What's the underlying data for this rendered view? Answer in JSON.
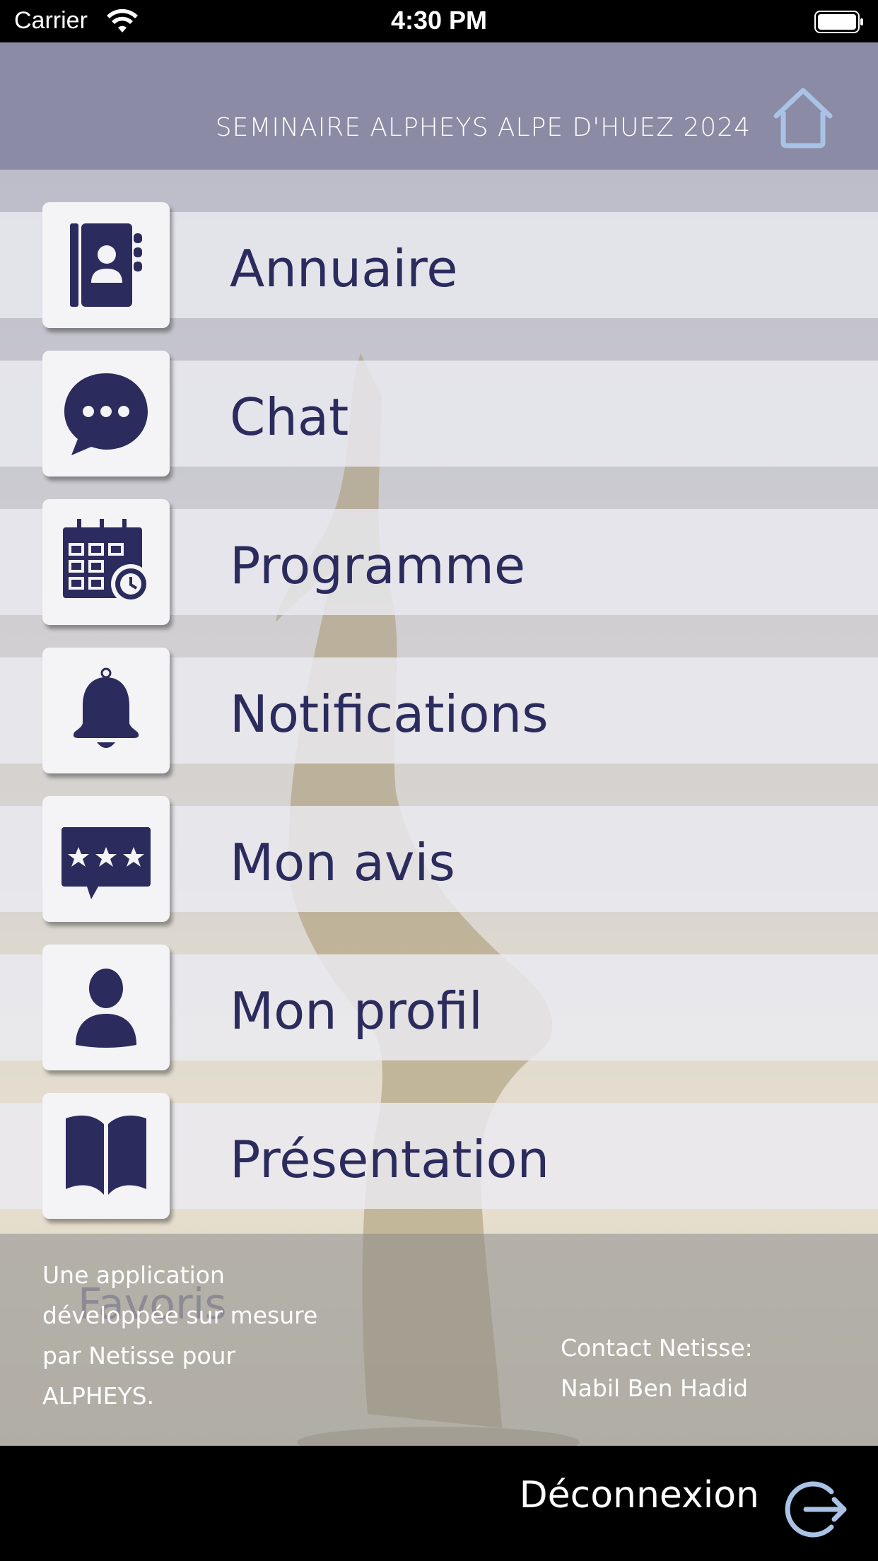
{
  "status_bar": {
    "carrier": "Carrier",
    "time": "4:30 PM",
    "wifi_icon": "wifi-icon",
    "battery_icon": "battery-icon"
  },
  "header": {
    "title": "SEMINAIRE ALPHEYS ALPE D'HUEZ 2024",
    "home_icon": "home-icon"
  },
  "menu": [
    {
      "label": "Annuaire",
      "icon": "address-book-icon"
    },
    {
      "label": "Chat",
      "icon": "chat-bubble-icon"
    },
    {
      "label": "Programme",
      "icon": "calendar-clock-icon"
    },
    {
      "label": "Notifications",
      "icon": "bell-icon"
    },
    {
      "label": "Mon avis",
      "icon": "rating-stars-icon"
    },
    {
      "label": "Mon profil",
      "icon": "user-icon"
    },
    {
      "label": "Présentation",
      "icon": "open-book-icon"
    }
  ],
  "footer": {
    "left_lines": [
      "Une application",
      "développée sur mesure",
      "par Netisse pour",
      "ALPHEYS."
    ],
    "right_lines": [
      "Contact Netisse:",
      "Nabil Ben Hadid"
    ],
    "ghost_text": "Favoris"
  },
  "bottom": {
    "logout_label": "Déconnexion",
    "logout_icon": "logout-icon"
  },
  "colors": {
    "header_bg": "#8b8ba5",
    "accent_navy": "#2b2b5e",
    "icon_light_blue": "#a9c3e6"
  }
}
